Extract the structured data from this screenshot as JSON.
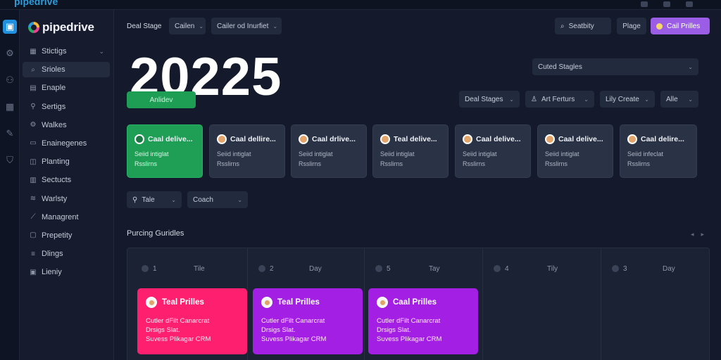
{
  "topbar": {
    "logo_text": "pipedrive"
  },
  "sidebar": {
    "brand": "pipedrive",
    "items": [
      {
        "label": "Stictigs",
        "icon": "grid-icon",
        "caret": "⌄"
      },
      {
        "label": "Srioles",
        "icon": "search-icon"
      },
      {
        "label": "Enaple",
        "icon": "mail-icon"
      },
      {
        "label": "Sertigs",
        "icon": "pin-icon"
      },
      {
        "label": "Walkes",
        "icon": "gear-icon"
      },
      {
        "label": "Enainegenes",
        "icon": "monitor-icon"
      },
      {
        "label": "Planting",
        "icon": "chat-icon"
      },
      {
        "label": "Sectucts",
        "icon": "calendar-icon"
      },
      {
        "label": "Warlsty",
        "icon": "wifi-icon"
      },
      {
        "label": "Managrent",
        "icon": "link-icon"
      },
      {
        "label": "Prepetity",
        "icon": "document-icon"
      },
      {
        "label": "Dlings",
        "icon": "list-icon"
      },
      {
        "label": "Lieniy",
        "icon": "box-icon"
      }
    ]
  },
  "header": {
    "deal_stage_label": "Deal Stage",
    "filter1": "Cailen",
    "filter2": "Cailer od Inurfiet",
    "search": "Seatbity",
    "page_btn": "Plage",
    "primary_btn": "Cail Prilles"
  },
  "hero": {
    "text": "20225",
    "green_button": "Anlidev"
  },
  "filters": {
    "sorted_stages": "Cuted Stagles",
    "deal_stages": "Deal Stages",
    "art_fertures": "Art Ferturs",
    "lily_create": "Lily Create",
    "alle": "Alle",
    "tale": "Tale",
    "coach": "Coach"
  },
  "cards": [
    {
      "title": "Caal delive...",
      "line1": "Seiid intiglat",
      "line2": "Rsslirns",
      "green": true
    },
    {
      "title": "Caal dellire...",
      "line1": "Seiid intiglat",
      "line2": "Rsslirns"
    },
    {
      "title": "Caal drlive...",
      "line1": "Seiid intiglat",
      "line2": "Rsslirns"
    },
    {
      "title": "Teal delive...",
      "line1": "Seiid intiglat",
      "line2": "Rsslirns"
    },
    {
      "title": "Caal delive...",
      "line1": "Seiid intiglat",
      "line2": "Rsslirns"
    },
    {
      "title": "Caal delive...",
      "line1": "Seiid intiglat",
      "line2": "Rsslirns"
    },
    {
      "title": "Caal delire...",
      "line1": "Seiid infeclat",
      "line2": "Rsslirns"
    }
  ],
  "section": {
    "title": "Purcing Guridles"
  },
  "board": {
    "columns": [
      {
        "num": "1",
        "label": "Tile"
      },
      {
        "num": "2",
        "label": "Day"
      },
      {
        "num": "5",
        "label": "Tay"
      },
      {
        "num": "4",
        "label": "Tily"
      },
      {
        "num": "3",
        "label": "Day"
      }
    ],
    "deals": [
      {
        "title": "Teal Prilles",
        "line1": "Cutler dFilt Canarcrat",
        "line2": "Drsigs Slat.",
        "line3": "Suvess Plikagar CRM",
        "color": "#ff1f6f"
      },
      {
        "title": "Teal Prilles",
        "line1": "Cutler dFilt Canarcrat",
        "line2": "Drsigs Slat.",
        "line3": "Suvess Plikagar CRM",
        "color": "#a21fe3"
      },
      {
        "title": "Caal Prilles",
        "line1": "Cutler dFilt Canarcrat",
        "line2": "Drsigs Slat.",
        "line3": "Suvess Plikagar CRM",
        "color": "#a21fe3"
      }
    ]
  },
  "colors": {
    "accent_purple": "#9b5de5",
    "green": "#1f9f56",
    "pink": "#ff1f6f"
  }
}
